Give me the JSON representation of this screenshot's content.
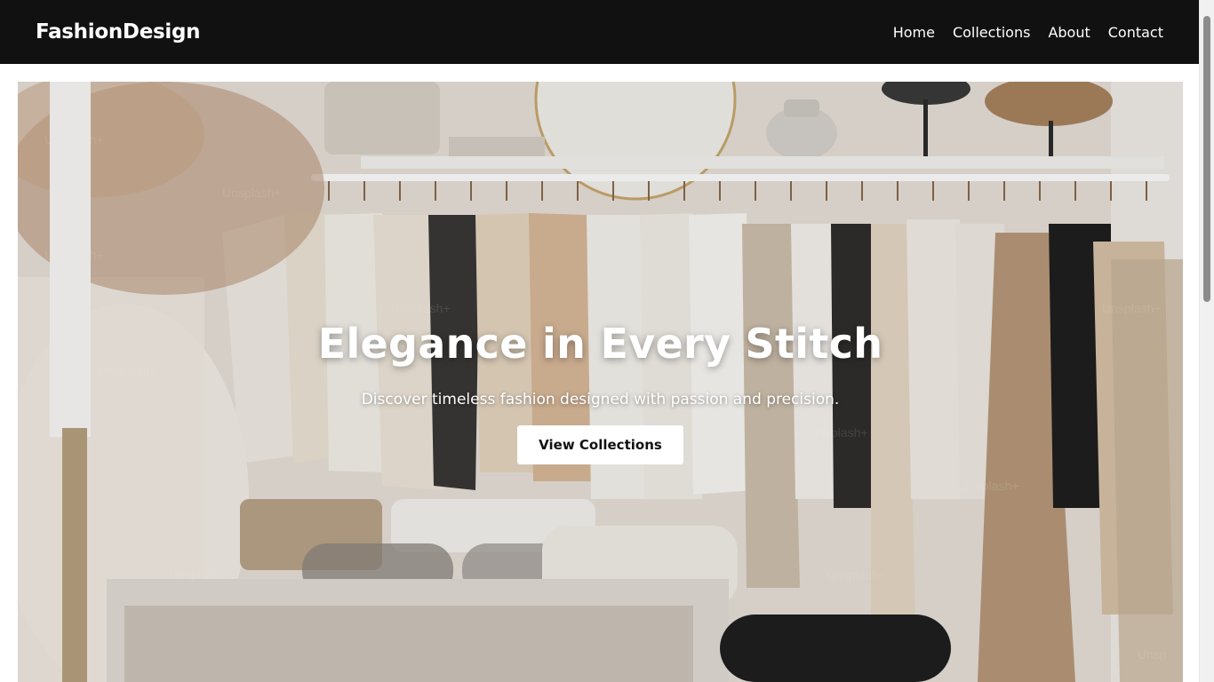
{
  "navbar": {
    "brand": "FashionDesign",
    "links": [
      "Home",
      "Collections",
      "About",
      "Contact"
    ]
  },
  "hero": {
    "title": "Elegance in Every Stitch",
    "subtitle": "Discover timeless fashion designed with passion and precision.",
    "cta_label": "View Collections"
  },
  "colors": {
    "navbar_bg": "#111111",
    "text_light": "#ffffff",
    "button_bg": "#ffffff",
    "button_text": "#111111"
  }
}
